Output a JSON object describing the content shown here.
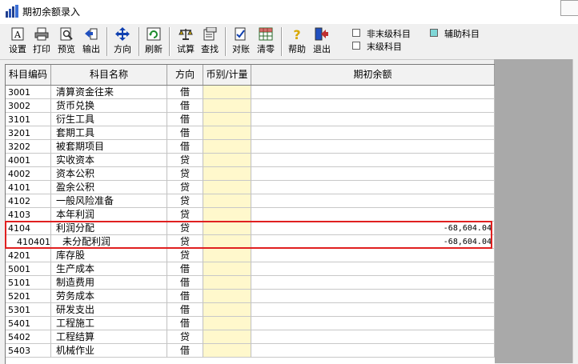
{
  "window": {
    "title": "期初余额录入"
  },
  "toolbar": {
    "buttons": [
      {
        "label": "设置",
        "icon": "settings-icon"
      },
      {
        "label": "打印",
        "icon": "printer-icon"
      },
      {
        "label": "预览",
        "icon": "preview-icon"
      },
      {
        "label": "输出",
        "icon": "export-icon"
      },
      {
        "label": "方向",
        "icon": "direction-icon"
      },
      {
        "label": "刷新",
        "icon": "refresh-icon"
      },
      {
        "label": "试算",
        "icon": "balance-scale-icon"
      },
      {
        "label": "查找",
        "icon": "find-icon"
      },
      {
        "label": "对账",
        "icon": "reconcile-icon"
      },
      {
        "label": "清零",
        "icon": "clear-zero-icon"
      },
      {
        "label": "帮助",
        "icon": "help-icon"
      },
      {
        "label": "退出",
        "icon": "exit-icon"
      }
    ]
  },
  "legend": {
    "non_leaf": "非末级科目",
    "auxiliary": "辅助科目",
    "leaf": "末级科目",
    "auxiliary_color": "#7fd7d7"
  },
  "table": {
    "headers": {
      "code": "科目编码",
      "name": "科目名称",
      "direction": "方向",
      "currency": "币别/计量",
      "amount": "期初余额"
    },
    "rows": [
      {
        "code": "3001",
        "name": "清算资金往来",
        "dir": "借",
        "amount": ""
      },
      {
        "code": "3002",
        "name": "货币兑换",
        "dir": "借",
        "amount": ""
      },
      {
        "code": "3101",
        "name": "衍生工具",
        "dir": "借",
        "amount": ""
      },
      {
        "code": "3201",
        "name": "套期工具",
        "dir": "借",
        "amount": ""
      },
      {
        "code": "3202",
        "name": "被套期项目",
        "dir": "借",
        "amount": ""
      },
      {
        "code": "4001",
        "name": "实收资本",
        "dir": "贷",
        "amount": ""
      },
      {
        "code": "4002",
        "name": "资本公积",
        "dir": "贷",
        "amount": ""
      },
      {
        "code": "4101",
        "name": "盈余公积",
        "dir": "贷",
        "amount": ""
      },
      {
        "code": "4102",
        "name": "一般风险准备",
        "dir": "贷",
        "amount": ""
      },
      {
        "code": "4103",
        "name": "本年利润",
        "dir": "贷",
        "amount": ""
      },
      {
        "code": "4104",
        "name": "利润分配",
        "dir": "贷",
        "amount": "-68,604.04"
      },
      {
        "code": "410401",
        "name": "未分配利润",
        "dir": "贷",
        "amount": "-68,604.04"
      },
      {
        "code": "4201",
        "name": "库存股",
        "dir": "贷",
        "amount": ""
      },
      {
        "code": "5001",
        "name": "生产成本",
        "dir": "借",
        "amount": ""
      },
      {
        "code": "5101",
        "name": "制造费用",
        "dir": "借",
        "amount": ""
      },
      {
        "code": "5201",
        "name": "劳务成本",
        "dir": "借",
        "amount": ""
      },
      {
        "code": "5301",
        "name": "研发支出",
        "dir": "借",
        "amount": ""
      },
      {
        "code": "5401",
        "name": "工程施工",
        "dir": "借",
        "amount": ""
      },
      {
        "code": "5402",
        "name": "工程结算",
        "dir": "贷",
        "amount": ""
      },
      {
        "code": "5403",
        "name": "机械作业",
        "dir": "借",
        "amount": ""
      }
    ]
  },
  "colors": {
    "highlight": "#e02020",
    "currency_cell": "#fff8cc"
  }
}
